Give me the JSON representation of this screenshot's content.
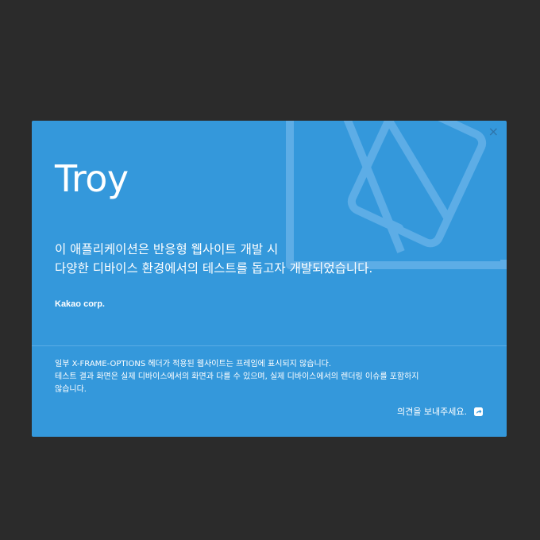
{
  "modal": {
    "title": "Troy",
    "close_label": "×",
    "description": [
      "이 애플리케이션은 반응형 웹사이트 개발 시",
      "다양한 디바이스 환경에서의 테스트를 돕고자 개발되었습니다."
    ],
    "company": "Kakao corp.",
    "notes": [
      "일부 X-FRAME-OPTIONS 헤더가 적용된 웹사이트는 프레임에 표시되지 않습니다.",
      "테스트 결과 화면은 실제 디바이스에서의 화면과 다를 수 있으며, 실제 디바이스에서의 렌더링 이슈를 포함하지",
      "않습니다."
    ],
    "feedback_label": "의견을 보내주세요.",
    "feedback_icon": "external-link-icon"
  },
  "colors": {
    "backdrop": "#2b2b2b",
    "modal_bg": "#3498db",
    "close": "#2f74a9",
    "text": "#ffffff"
  }
}
